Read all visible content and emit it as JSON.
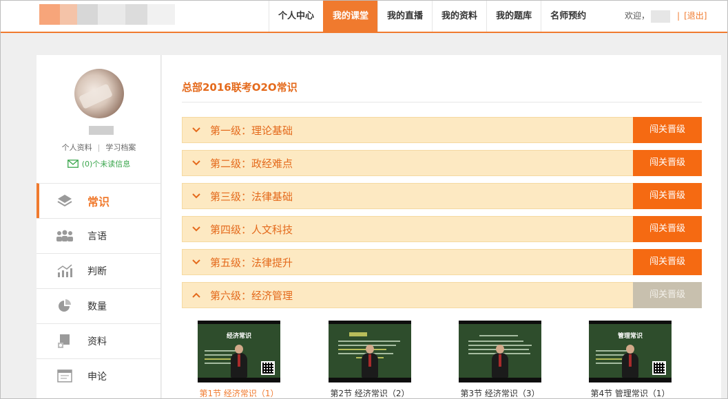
{
  "header": {
    "nav": [
      {
        "label": "个人中心",
        "active": false
      },
      {
        "label": "我的课堂",
        "active": true
      },
      {
        "label": "我的直播",
        "active": false
      },
      {
        "label": "我的资料",
        "active": false
      },
      {
        "label": "我的题库",
        "active": false
      },
      {
        "label": "名师预约",
        "active": false
      }
    ],
    "welcome": "欢迎，",
    "separator": "|",
    "logout": "[退出]"
  },
  "profile": {
    "link_profile": "个人资料",
    "link_separator": "|",
    "link_archive": "学习档案",
    "messages": "(0)个未读信息"
  },
  "sidebar": {
    "items": [
      {
        "label": "常识",
        "icon": "layers-icon",
        "active": true
      },
      {
        "label": "言语",
        "icon": "people-icon",
        "active": false
      },
      {
        "label": "判断",
        "icon": "chart-trend-icon",
        "active": false
      },
      {
        "label": "数量",
        "icon": "pie-chart-icon",
        "active": false
      },
      {
        "label": "资料",
        "icon": "document-icon",
        "active": false
      },
      {
        "label": "申论",
        "icon": "window-icon",
        "active": false
      }
    ]
  },
  "main": {
    "course_title": "总部2016联考O2O常识",
    "levels": [
      {
        "name": "第一级：理论基础",
        "button": "闯关晋级",
        "expanded": false,
        "unlocked": true
      },
      {
        "name": "第二级：政经难点",
        "button": "闯关晋级",
        "expanded": false,
        "unlocked": true
      },
      {
        "name": "第三级：法律基础",
        "button": "闯关晋级",
        "expanded": false,
        "unlocked": true
      },
      {
        "name": "第四级：人文科技",
        "button": "闯关晋级",
        "expanded": false,
        "unlocked": true
      },
      {
        "name": "第五级：法律提升",
        "button": "闯关晋级",
        "expanded": false,
        "unlocked": true
      },
      {
        "name": "第六级：经济管理",
        "button": "闯关晋级",
        "expanded": true,
        "unlocked": false
      }
    ],
    "lessons": [
      {
        "caption": "第1节 经济常识（1）",
        "thumb_title": "经济常识",
        "active": true
      },
      {
        "caption": "第2节 经济常识（2）",
        "thumb_title": "",
        "active": false
      },
      {
        "caption": "第3节 经济常识（3）",
        "thumb_title": "",
        "active": false
      },
      {
        "caption": "第4节 管理常识（1）",
        "thumb_title": "管理常识",
        "active": false
      }
    ]
  },
  "colors": {
    "accent": "#f07a2e",
    "level_bg": "#fde9c2",
    "button": "#f56a12",
    "button_disabled": "#c8c0ae"
  }
}
